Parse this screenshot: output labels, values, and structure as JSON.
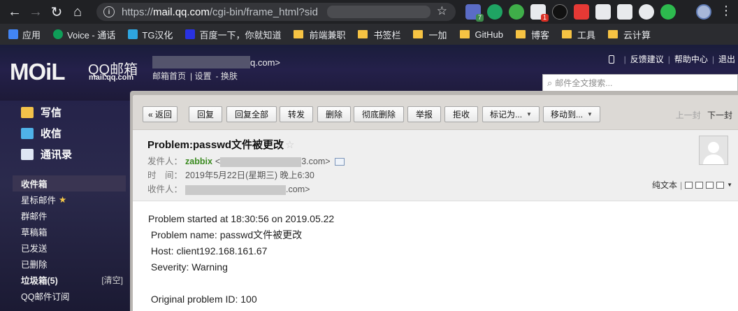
{
  "browser": {
    "url_prefix": "https://",
    "url_host": "mail.qq.com",
    "url_path": "/cgi-bin/frame_html?sid",
    "ext_badge_1": "7",
    "ext_badge_2": "1",
    "bookmarks": [
      {
        "label": "应用",
        "icon": "apps-icon",
        "color": "#4285f4"
      },
      {
        "label": "Voice - 通话",
        "icon": "voice-icon",
        "color": "#0f9d58"
      },
      {
        "label": "TG汉化",
        "icon": "telegram-icon",
        "color": "#2ea6e0"
      },
      {
        "label": "百度一下，你就知道",
        "icon": "baidu-icon",
        "color": "#2932e1"
      },
      {
        "label": "前端兼职",
        "icon": "folder-icon"
      },
      {
        "label": "书签栏",
        "icon": "folder-icon"
      },
      {
        "label": "一加",
        "icon": "folder-icon"
      },
      {
        "label": "GitHub",
        "icon": "folder-icon"
      },
      {
        "label": "博客",
        "icon": "folder-icon"
      },
      {
        "label": "工具",
        "icon": "folder-icon"
      },
      {
        "label": "云计算",
        "icon": "folder-icon"
      }
    ]
  },
  "header": {
    "logo": "MOiL",
    "brand": "QQ邮箱",
    "domain": "mail.qq.com",
    "user_suffix": "q.com>",
    "links": [
      "邮箱首页",
      "设置",
      "换肤"
    ],
    "right_links": [
      "反馈建议",
      "帮助中心",
      "退出"
    ],
    "search_placeholder": "邮件全文搜索..."
  },
  "sidebar": {
    "quick": [
      {
        "label": "写信",
        "icon": "compose-icon"
      },
      {
        "label": "收信",
        "icon": "receive-icon"
      },
      {
        "label": "通讯录",
        "icon": "contacts-icon"
      }
    ],
    "folders": [
      {
        "label": "收件箱"
      },
      {
        "label": "星标邮件"
      },
      {
        "label": "群邮件"
      },
      {
        "label": "草稿箱"
      },
      {
        "label": "已发送"
      },
      {
        "label": "已删除"
      },
      {
        "label": "垃圾箱(5)"
      },
      {
        "label": "QQ邮件订阅"
      }
    ],
    "clear_label": "[清空]"
  },
  "toolbar": {
    "back": "« 返回",
    "reply": "回复",
    "reply_all": "回复全部",
    "forward": "转发",
    "delete": "删除",
    "delete_perm": "彻底删除",
    "report": "举报",
    "reject": "拒收",
    "mark_as": "标记为...",
    "move_to": "移动到...",
    "prev": "上一封",
    "next": "下一封"
  },
  "mail": {
    "subject": "Problem:passwd文件被更改",
    "from_label": "发件人：",
    "from_name": "zabbix",
    "from_addr_prefix": "<",
    "from_addr_suffix": "3.com>",
    "time_label": "时　间：",
    "time_value": "2019年5月22日(星期三) 晚上6:30",
    "to_label": "收件人：",
    "to_suffix": ".com>",
    "plain_text": "纯文本",
    "body": [
      "Problem started at 18:30:56 on 2019.05.22",
      " Problem name: passwd文件被更改",
      " Host: client192.168.161.67",
      " Severity: Warning",
      "",
      " Original problem ID: 100"
    ]
  }
}
